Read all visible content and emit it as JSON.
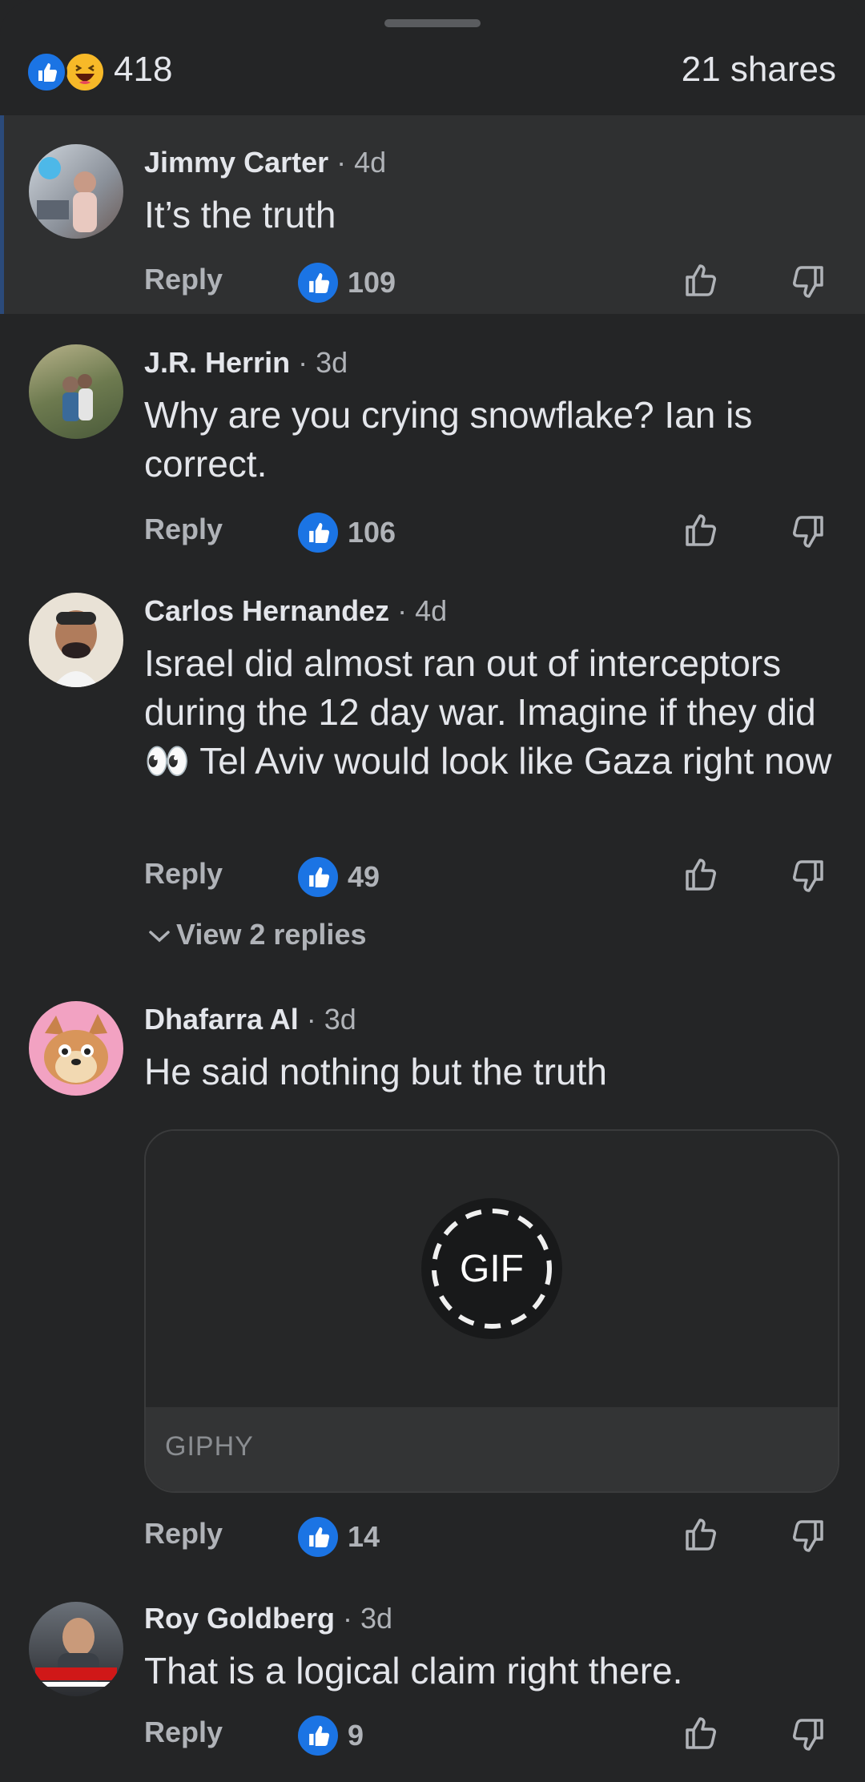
{
  "summary": {
    "reaction_count": "418",
    "shares": "21 shares"
  },
  "actions": {
    "reply_label": "Reply",
    "view_replies_label": "View 2 replies"
  },
  "comments": [
    {
      "name": "Jimmy Carter",
      "time": "· 4d",
      "text": "It’s the truth",
      "likes": "109"
    },
    {
      "name": "J.R. Herrin",
      "time": "· 3d",
      "text": "Why are you crying snowflake? Ian is correct.",
      "likes": "106"
    },
    {
      "name": "Carlos Hernandez",
      "time": "· 4d",
      "text": "Israel did almost ran out of interceptors during the 12 day war. Imagine if they did 👀 Tel Aviv would look like Gaza right now",
      "likes": "49"
    },
    {
      "name": "Dhafarra Al",
      "time": "· 3d",
      "text": "He said nothing but the truth",
      "likes": "14"
    },
    {
      "name": "Roy Goldberg",
      "time": "· 3d",
      "text": "That is a logical claim right there.",
      "likes": "9"
    }
  ],
  "gif": {
    "badge": "GIF",
    "source": "GIPHY"
  },
  "icons": {
    "like": "thumbs-up-icon",
    "haha": "laughing-face-icon",
    "upvote": "thumb-up-outline-icon",
    "downvote": "thumb-down-outline-icon",
    "chevron": "chevron-down-icon"
  },
  "colors": {
    "background": "#242526",
    "highlight": "#2f3031",
    "accent": "#1b74e4",
    "haha": "#f7b928",
    "secondary_text": "#b0b3b8"
  }
}
